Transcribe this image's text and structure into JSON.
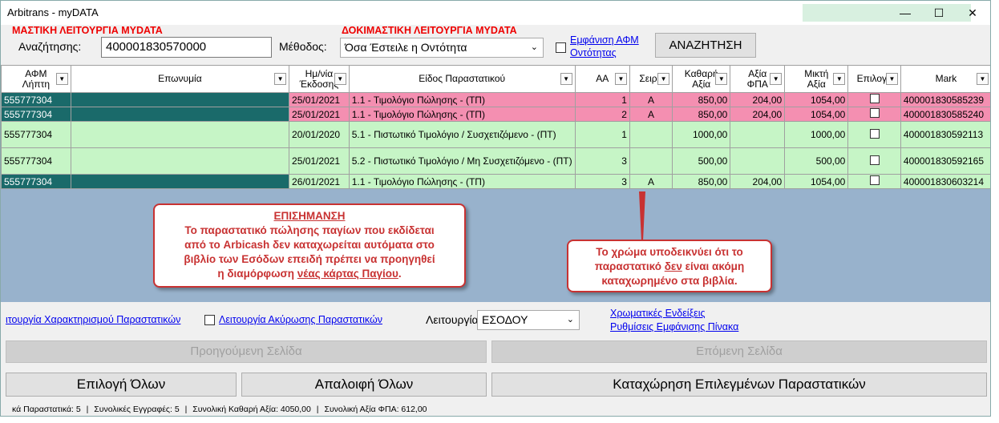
{
  "window": {
    "title": "Arbitrans - myDATA",
    "minimize": "—",
    "maximize": "☐",
    "close": "✕"
  },
  "banner_left": "ΜΑΣΤΙΚΗ ΛΕΙΤΟΥΡΓΙΑ MYDATA",
  "banner_right": "ΔΟΚΙΜΑΣΤΙΚΗ ΛΕΙΤΟΥΡΓΙΑ MYDATA",
  "search": {
    "label": "Αναζήτησης:",
    "value": "400001830570000"
  },
  "method": {
    "label": "Μέθοδος:",
    "value": "Όσα Έστειλε η Οντότητα"
  },
  "show_afm_link_1": "Εμφάνιση ΑΦΜ",
  "show_afm_link_2": "Οντότητας",
  "search_button": "ΑΝΑΖΗΤΗΣΗ",
  "table": {
    "headers": [
      "ΑΦΜ\nΛήπτη",
      "Επωνυμία",
      "Ημ/νία\nΈκδοσης",
      "Είδος Παραστατικού",
      "ΑΑ",
      "Σειρά",
      "Καθαρή\nΑξία",
      "Αξία\nΦΠΑ",
      "Μικτή\nΑξία",
      "Επιλογή",
      "Mark"
    ],
    "rows": [
      {
        "afm": "555777304",
        "name": "",
        "date": "25/01/2021",
        "type": "1.1 - Τιμολόγιο Πώλησης - (ΤΠ)",
        "aa": "1",
        "series": "A",
        "net": "850,00",
        "vat": "204,00",
        "gross": "1054,00",
        "mark": "400001830585239",
        "color": "pink"
      },
      {
        "afm": "555777304",
        "name": "",
        "date": "25/01/2021",
        "type": "1.1 - Τιμολόγιο Πώλησης - (ΤΠ)",
        "aa": "2",
        "series": "A",
        "net": "850,00",
        "vat": "204,00",
        "gross": "1054,00",
        "mark": "400001830585240",
        "color": "pink"
      },
      {
        "afm": "555777304",
        "name": "",
        "date": "20/01/2020",
        "type": "5.1 - Πιστωτικό Τιμολόγιο / Συσχετιζόμενο - (ΠΤ)",
        "aa": "1",
        "series": "",
        "net": "1000,00",
        "vat": "",
        "gross": "1000,00",
        "mark": "400001830592113",
        "color": "green"
      },
      {
        "afm": "555777304",
        "name": "",
        "date": "25/01/2021",
        "type": "5.2 - Πιστωτικό Τιμολόγιο / Μη Συσχετιζόμενο - (ΠΤ)",
        "aa": "3",
        "series": "",
        "net": "500,00",
        "vat": "",
        "gross": "500,00",
        "mark": "400001830592165",
        "color": "green"
      },
      {
        "afm": "555777304",
        "name": "",
        "date": "26/01/2021",
        "type": "1.1 - Τιμολόγιο Πώλησης - (ΤΠ)",
        "aa": "3",
        "series": "A",
        "net": "850,00",
        "vat": "204,00",
        "gross": "1054,00",
        "mark": "400001830603214",
        "color": "green"
      }
    ]
  },
  "callout_left": {
    "heading": "ΕΠΙΣΗΜΑΝΣΗ",
    "line1": "Το παραστατικό πώλησης παγίων που εκδίδεται",
    "line2": "από το Arbicash δεν καταχωρείται αυτόματα στο",
    "line3": "βιβλίο των Εσόδων επειδή πρέπει να προηγηθεί",
    "line4_pre": "η διαμόρφωση ",
    "line4_u": "νέας κάρτας Παγίου",
    "line4_post": "."
  },
  "callout_right": {
    "line1": "Το χρώμα υποδεικνύει ότι το",
    "line2_pre": "παραστατικό ",
    "line2_u": "δεν",
    "line2_post": " είναι ακόμη",
    "line3": "καταχωρημένο στα βιβλία."
  },
  "bottom": {
    "link_characterization": "ιτουργία Χαρακτηρισμού Παραστατικών",
    "link_cancellation": "Λειτουργία Ακύρωσης Παραστατικών",
    "operation_label": "Λειτουργία:",
    "operation_value": "ΕΣΟΔΟΥ",
    "link_colors": "Χρωματικές Ενδείξεις",
    "link_table_settings": "Ρυθμίσεις Εμφάνισης Πίνακα",
    "prev_page": "Προηγούμενη Σελίδα",
    "next_page": "Επόμενη Σελίδα",
    "select_all": "Επιλογή Όλων",
    "deselect_all": "Απαλοιφή Όλων",
    "register_selected": "Καταχώρηση Επιλεγμένων Παραστατικών"
  },
  "status": {
    "docs": "κά Παραστατικά: 5",
    "records": "Συνολικές Εγγραφές: 5",
    "net_total": "Συνολική Καθαρή Αξία: 4050,00",
    "vat_total": "Συνολική Αξία ΦΠΑ: 612,00"
  },
  "colors": {
    "pink_row": "#f48fb1",
    "green_row": "#c6f5c6",
    "teal_cell": "#1a6a6a",
    "grid_bg": "#98b2cc",
    "banner_red": "#ee0000",
    "callout_red": "#c83232"
  }
}
